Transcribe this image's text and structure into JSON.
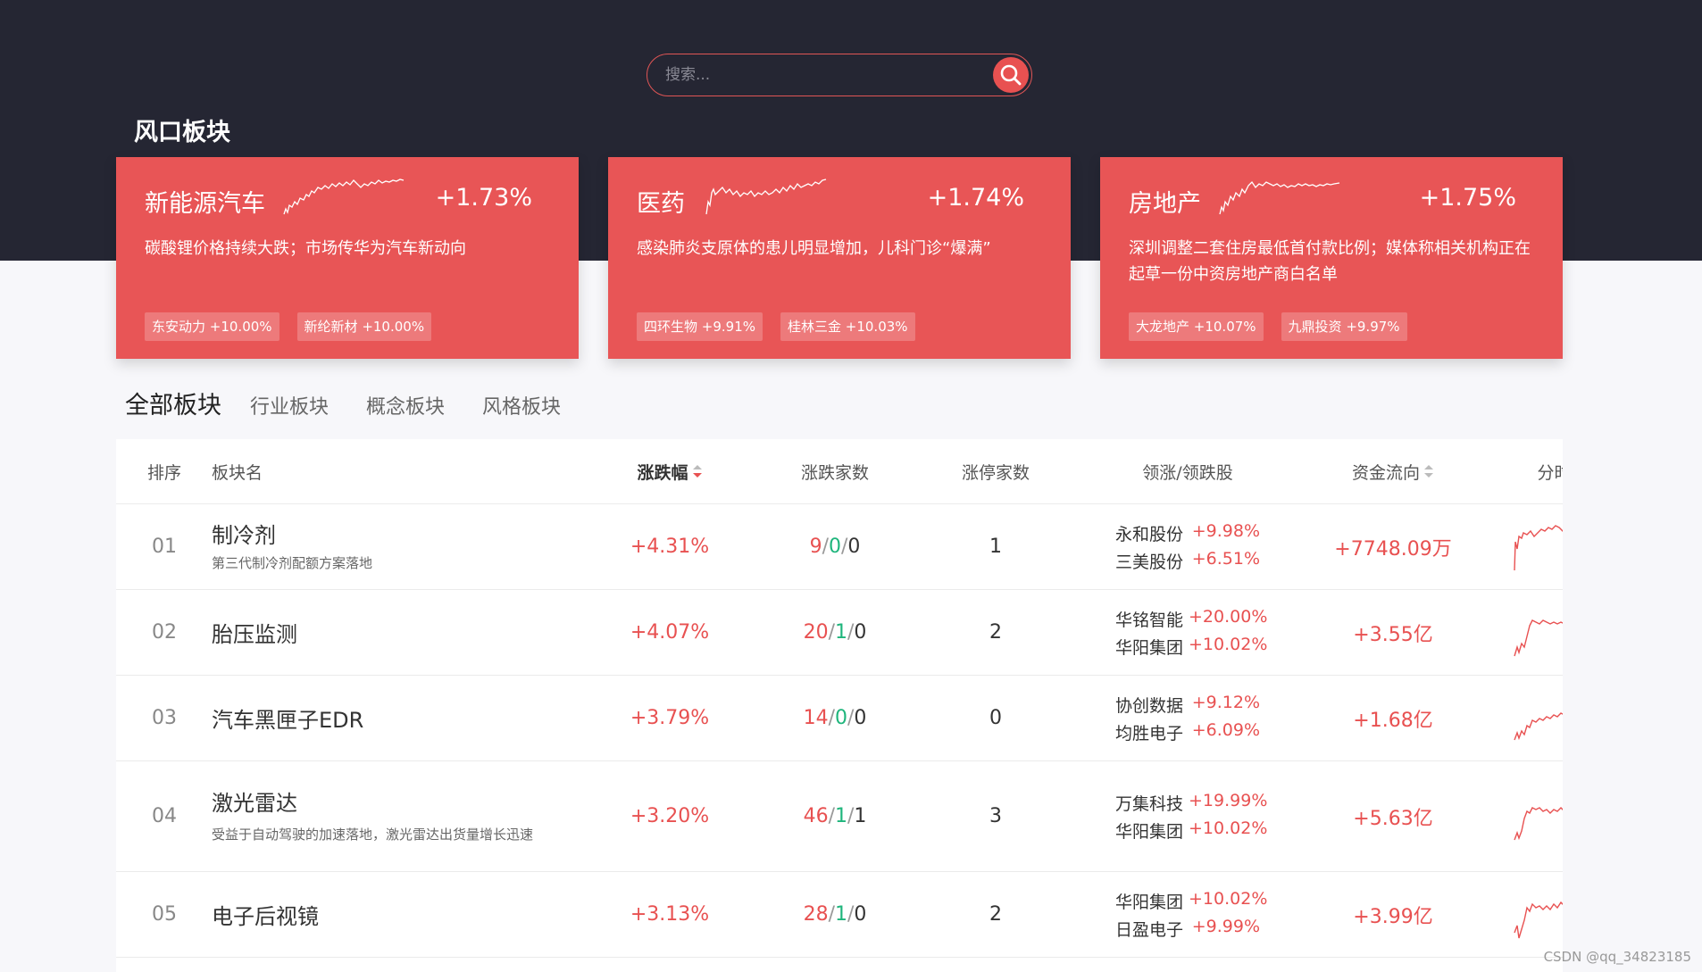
{
  "search": {
    "placeholder": "搜索..."
  },
  "section_title": "风口板块",
  "hot_cards": [
    {
      "name": "新能源汽车",
      "pct": "+1.73%",
      "news": "碳酸锂价格持续大跌；市场传华为汽车新动向",
      "tags": [
        "东安动力 +10.00%",
        "新纶新材 +10.00%"
      ]
    },
    {
      "name": "医药",
      "pct": "+1.74%",
      "news": "感染肺炎支原体的患儿明显增加，儿科门诊“爆满”",
      "tags": [
        "四环生物 +9.91%",
        "桂林三金 +10.03%"
      ]
    },
    {
      "name": "房地产",
      "pct": "+1.75%",
      "news": "深圳调整二套住房最低首付款比例；媒体称相关机构正在起草一份中资房地产商白名单",
      "tags": [
        "大龙地产 +10.07%",
        "九鼎投资 +9.97%"
      ]
    }
  ],
  "tabs": [
    "全部板块",
    "行业板块",
    "概念板块",
    "风格板块"
  ],
  "table": {
    "headers": {
      "rank": "排序",
      "name": "板块名",
      "change": "涨跌幅",
      "count": "涨跌家数",
      "limit": "涨停家数",
      "leader": "领涨/领跌股",
      "flow": "资金流向",
      "chart": "分时图"
    },
    "rows": [
      {
        "rank": "01",
        "name": "制冷剂",
        "desc": "第三代制冷剂配额方案落地",
        "change": "+4.31%",
        "up": "9",
        "down": "0",
        "flat": "0",
        "limit": "1",
        "leaders": [
          {
            "name": "永和股份",
            "pct": "+9.98%"
          },
          {
            "name": "三美股份",
            "pct": "+6.51%"
          }
        ],
        "flow": "+7748.09万"
      },
      {
        "rank": "02",
        "name": "胎压监测",
        "desc": "",
        "change": "+4.07%",
        "up": "20",
        "down": "1",
        "flat": "0",
        "limit": "2",
        "leaders": [
          {
            "name": "华铭智能",
            "pct": "+20.00%"
          },
          {
            "name": "华阳集团",
            "pct": "+10.02%"
          }
        ],
        "flow": "+3.55亿"
      },
      {
        "rank": "03",
        "name": "汽车黑匣子EDR",
        "desc": "",
        "change": "+3.79%",
        "up": "14",
        "down": "0",
        "flat": "0",
        "limit": "0",
        "leaders": [
          {
            "name": "协创数据",
            "pct": "+9.12%"
          },
          {
            "name": "均胜电子",
            "pct": "+6.09%"
          }
        ],
        "flow": "+1.68亿"
      },
      {
        "rank": "04",
        "name": "激光雷达",
        "desc": "受益于自动驾驶的加速落地，激光雷达出货量增长迅速",
        "change": "+3.20%",
        "up": "46",
        "down": "1",
        "flat": "1",
        "limit": "3",
        "leaders": [
          {
            "name": "万集科技",
            "pct": "+19.99%"
          },
          {
            "name": "华阳集团",
            "pct": "+10.02%"
          }
        ],
        "flow": "+5.63亿"
      },
      {
        "rank": "05",
        "name": "电子后视镜",
        "desc": "",
        "change": "+3.13%",
        "up": "28",
        "down": "1",
        "flat": "0",
        "limit": "2",
        "leaders": [
          {
            "name": "华阳集团",
            "pct": "+10.02%"
          },
          {
            "name": "日盈电子",
            "pct": "+9.99%"
          }
        ],
        "flow": "+3.99亿"
      }
    ]
  },
  "watermark": "CSDN @qq_34823185",
  "colors": {
    "accent": "#e85151",
    "card": "#e85556",
    "dark_band": "#252633",
    "green": "#1fb57c"
  }
}
